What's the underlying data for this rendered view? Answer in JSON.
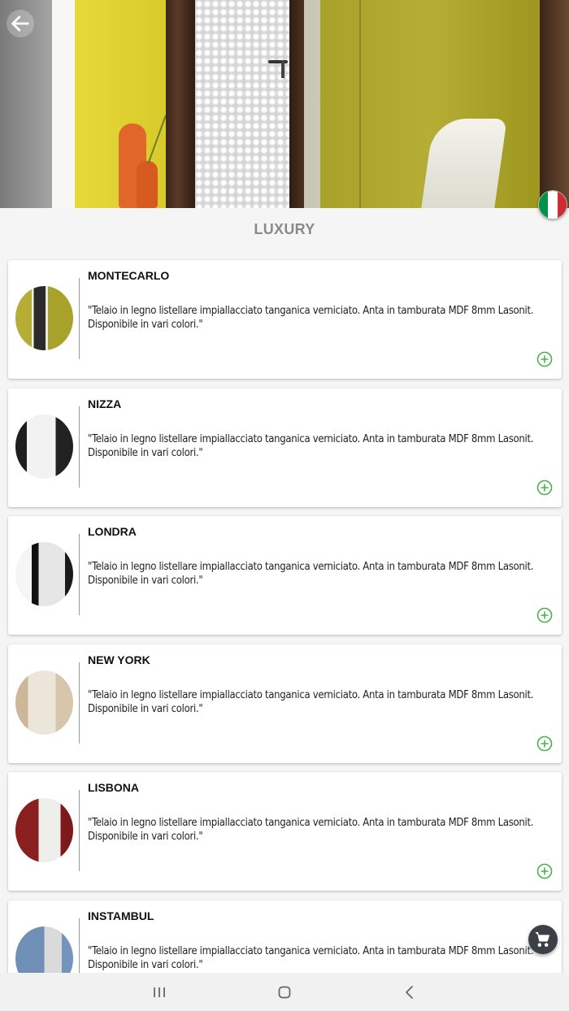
{
  "header": {
    "back_icon": "arrow-left-icon",
    "language_flag": "italy-flag-icon",
    "flag_colors": [
      "#009246",
      "#ffffff",
      "#ce2b37"
    ]
  },
  "section": {
    "title": "LUXURY"
  },
  "products": [
    {
      "name": "MONTECARLO",
      "description": "\"Telaio in legno listellare impiallacciato tanganica verniciato. Anta in tamburata MDF 8mm Lasonit. Disponibile in vari colori.\"",
      "add_icon": "plus-circle-icon"
    },
    {
      "name": "NIZZA",
      "description": "\"Telaio in legno listellare impiallacciato tanganica verniciato. Anta in tamburata MDF 8mm Lasonit. Disponibile in vari colori.\"",
      "add_icon": "plus-circle-icon"
    },
    {
      "name": "LONDRA",
      "description": "\"Telaio in legno listellare impiallacciato tanganica verniciato. Anta in tamburata MDF 8mm Lasonit. Disponibile in vari colori.\"",
      "add_icon": "plus-circle-icon"
    },
    {
      "name": "NEW YORK",
      "description": "\"Telaio in legno listellare impiallacciato tanganica verniciato. Anta in tamburata MDF 8mm Lasonit. Disponibile in vari colori.\"",
      "add_icon": "plus-circle-icon"
    },
    {
      "name": "LISBONA",
      "description": "\"Telaio in legno listellare impiallacciato tanganica verniciato. Anta in tamburata MDF 8mm Lasonit. Disponibile in vari colori.\"",
      "add_icon": "plus-circle-icon"
    },
    {
      "name": "INSTAMBUL",
      "description": "\"Telaio in legno listellare impiallacciato tanganica verniciato. Anta in tamburata MDF 8mm Lasonit. Disponibile in vari colori.\"",
      "add_icon": "plus-circle-icon"
    }
  ],
  "cart": {
    "icon": "shopping-cart-icon"
  },
  "system_nav": {
    "recents_icon": "recents-icon",
    "home_icon": "home-icon",
    "back_icon": "chevron-left-icon"
  },
  "colors": {
    "accent_green": "#4caf50",
    "title_grey": "#8a8a8a",
    "fab_dark": "#3b3f46"
  }
}
